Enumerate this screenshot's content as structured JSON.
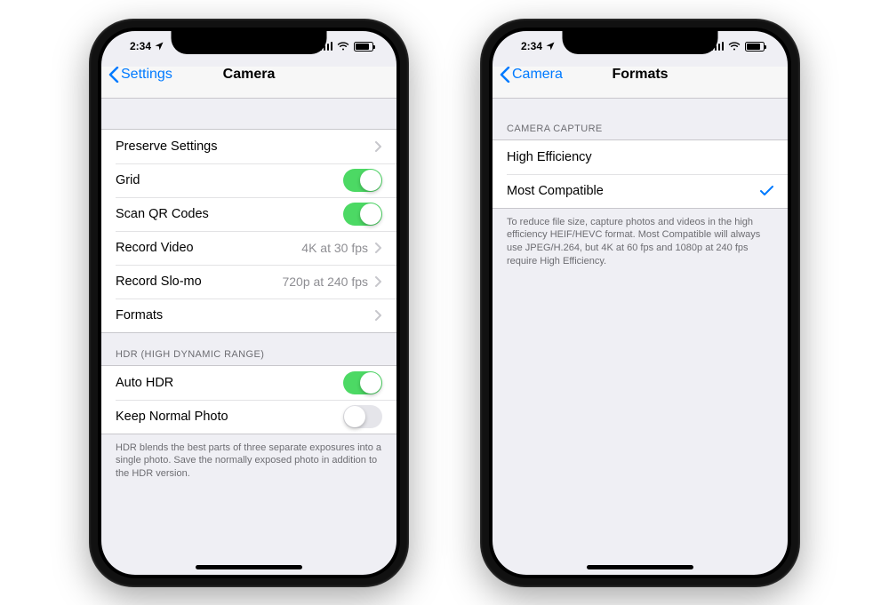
{
  "status": {
    "time": "2:34",
    "signal": 4,
    "wifi": true,
    "battery_pct": 75
  },
  "phone1": {
    "back_label": "Settings",
    "title": "Camera",
    "section1": {
      "preserve": {
        "label": "Preserve Settings"
      },
      "grid": {
        "label": "Grid",
        "on": true
      },
      "scan_qr": {
        "label": "Scan QR Codes",
        "on": true
      },
      "record_video": {
        "label": "Record Video",
        "detail": "4K at 30 fps"
      },
      "record_slomo": {
        "label": "Record Slo-mo",
        "detail": "720p at 240 fps"
      },
      "formats": {
        "label": "Formats"
      }
    },
    "section2_header": "HDR (HIGH DYNAMIC RANGE)",
    "section2": {
      "auto_hdr": {
        "label": "Auto HDR",
        "on": true
      },
      "keep_normal": {
        "label": "Keep Normal Photo",
        "on": false
      }
    },
    "section2_footer": "HDR blends the best parts of three separate exposures into a single photo. Save the normally exposed photo in addition to the HDR version."
  },
  "phone2": {
    "back_label": "Camera",
    "title": "Formats",
    "section1_header": "CAMERA CAPTURE",
    "section1": {
      "high_efficiency": {
        "label": "High Efficiency",
        "selected": false
      },
      "most_compatible": {
        "label": "Most Compatible",
        "selected": true
      }
    },
    "section1_footer": "To reduce file size, capture photos and videos in the high efficiency HEIF/HEVC format. Most Compatible will always use JPEG/H.264, but 4K at 60 fps and 1080p at 240 fps require High Efficiency."
  }
}
